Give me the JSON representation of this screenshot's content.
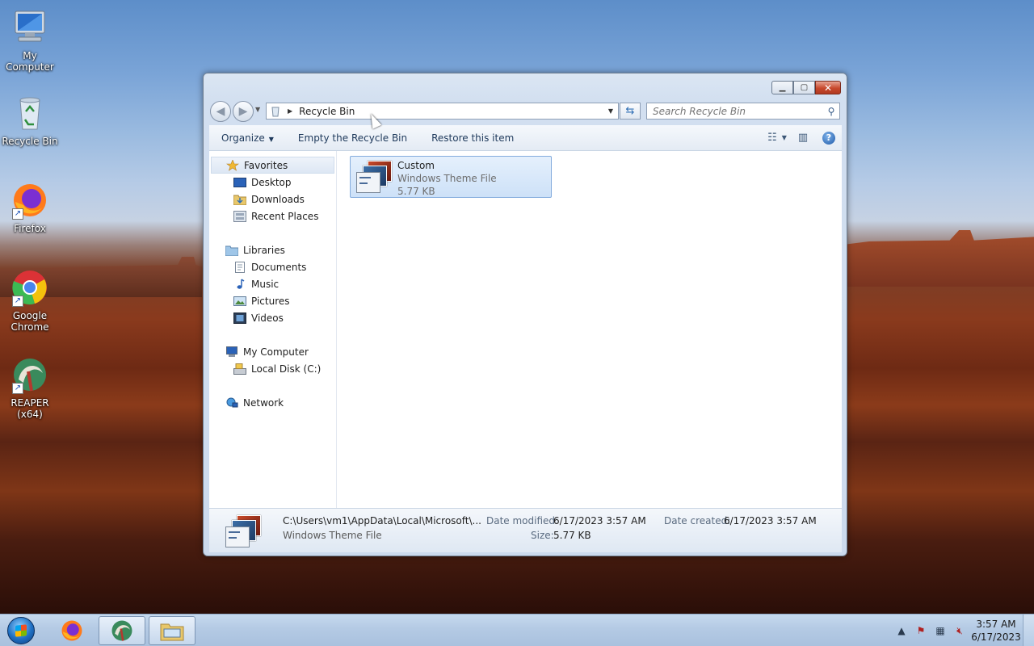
{
  "desktop": {
    "icons": [
      {
        "label": "My Computer",
        "icon": "computer-icon"
      },
      {
        "label": "Recycle Bin",
        "icon": "recycle-bin-icon"
      },
      {
        "label": "Firefox",
        "icon": "firefox-icon"
      },
      {
        "label": "Google Chrome",
        "icon": "chrome-icon"
      },
      {
        "label": "REAPER (x64)",
        "icon": "reaper-icon"
      }
    ]
  },
  "window": {
    "title_buttons": {
      "minimize": "▁",
      "maximize": "▢",
      "close": "✕"
    },
    "address": {
      "location": "Recycle Bin"
    },
    "search": {
      "placeholder": "Search Recycle Bin"
    },
    "toolbar": {
      "organize": "Organize",
      "empty": "Empty the Recycle Bin",
      "restore": "Restore this item"
    },
    "navpane": {
      "favorites": "Favorites",
      "desktop": "Desktop",
      "downloads": "Downloads",
      "recent": "Recent Places",
      "libraries": "Libraries",
      "documents": "Documents",
      "music": "Music",
      "pictures": "Pictures",
      "videos": "Videos",
      "computer": "My Computer",
      "local_disk": "Local Disk (C:)",
      "network": "Network"
    },
    "file": {
      "name": "Custom",
      "type": "Windows Theme File",
      "size": "5.77 KB"
    },
    "details": {
      "path": "C:\\Users\\vm1\\AppData\\Local\\Microsoft\\...",
      "type": "Windows Theme File",
      "date_modified_label": "Date modified:",
      "date_modified": "6/17/2023 3:57 AM",
      "size_label": "Size:",
      "size": "5.77 KB",
      "date_created_label": "Date created:",
      "date_created": "6/17/2023 3:57 AM"
    }
  },
  "taskbar": {
    "apps": [
      "firefox-icon",
      "reaper-icon",
      "explorer-icon"
    ],
    "clock_time": "3:57 AM",
    "clock_date": "6/17/2023"
  }
}
